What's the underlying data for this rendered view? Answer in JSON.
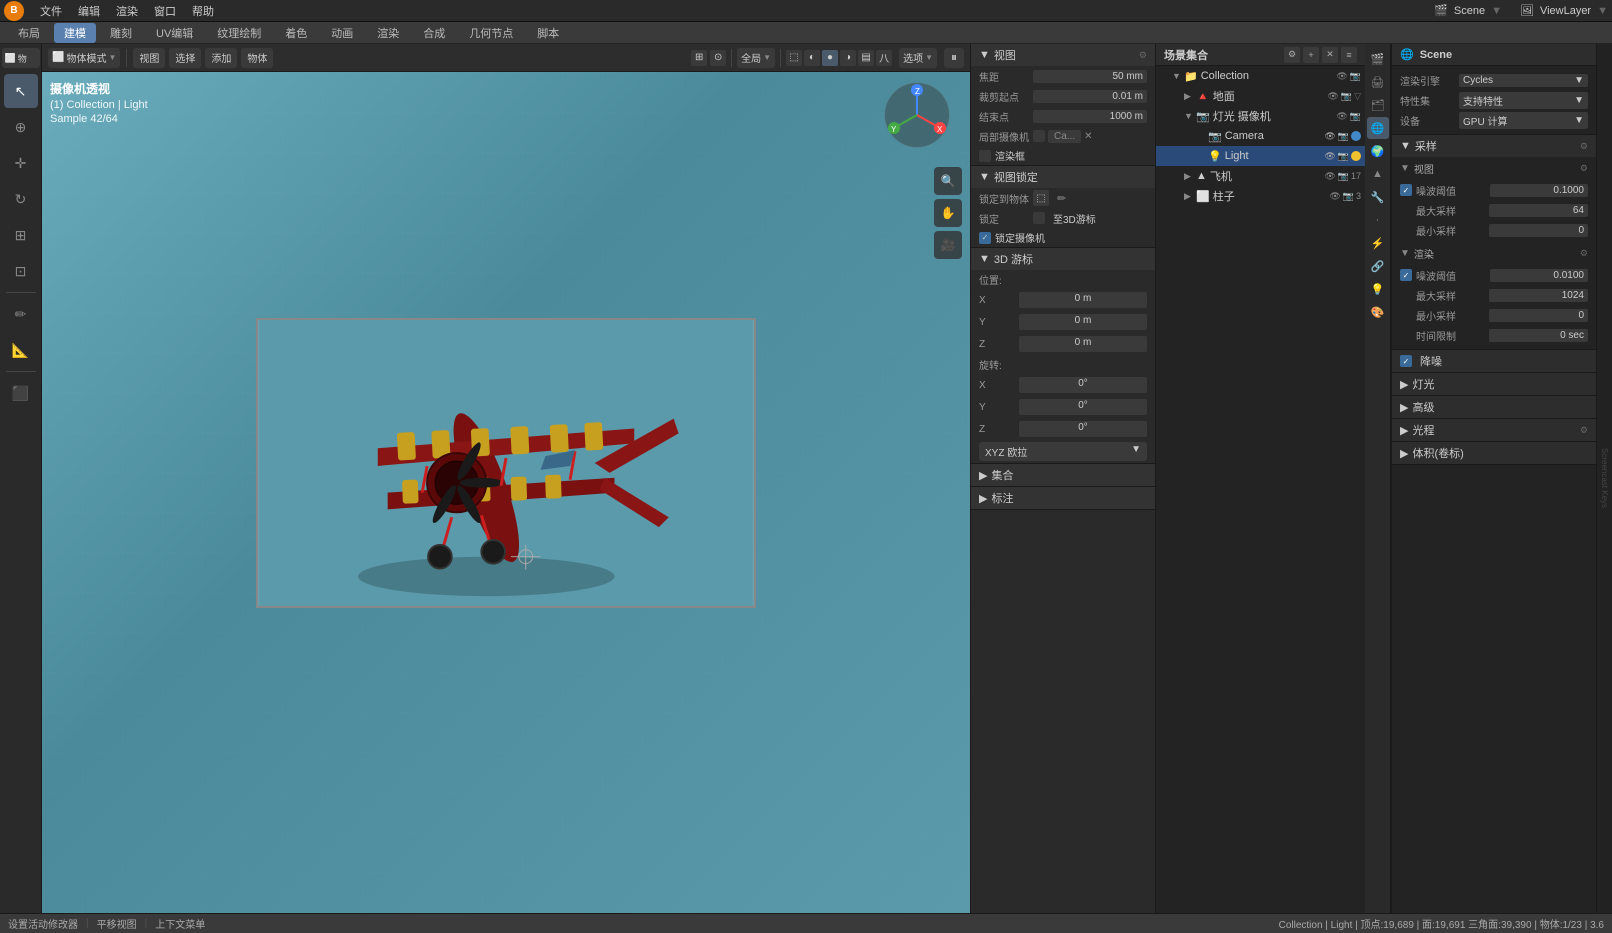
{
  "app": {
    "title": "Blender",
    "logo": "B"
  },
  "top_menu": {
    "items": [
      "文件",
      "编辑",
      "渲染",
      "窗口",
      "帮助"
    ]
  },
  "toolbar_tabs": {
    "items": [
      "布局",
      "建模",
      "雕刻",
      "UV编辑",
      "纹理绘制",
      "着色",
      "动画",
      "渲染",
      "合成",
      "几何节点",
      "脚本"
    ]
  },
  "viewport_toolbar": {
    "mode": "物体模式",
    "view": "视图",
    "select": "选择",
    "add": "添加",
    "object": "物体",
    "global": "全局",
    "options": "选项"
  },
  "viewport_info": {
    "title": "摄像机透视",
    "collection": "(1) Collection | Light",
    "sample": "Sample 42/64"
  },
  "right_panel": {
    "header": "视图",
    "focal_length_label": "焦距",
    "focal_length_value": "50 mm",
    "clip_start_label": "裁剪起点",
    "clip_start_value": "0.01 m",
    "clip_end_label": "结束点",
    "clip_end_value": "1000 m",
    "local_camera_label": "局部摄像机",
    "render_frame_label": "渲染框",
    "view_lock_header": "视图锁定",
    "lock_object_label": "锁定到物体",
    "lock_label": "锁定",
    "lock_to_3d_cursor_label": "至3D游标",
    "lock_camera_label": "锁定摄像机",
    "cursor_3d_header": "3D 游标",
    "position_label": "位置:",
    "x_label": "X",
    "x_value": "0 m",
    "y_label": "Y",
    "y_value": "0 m",
    "z_label": "Z",
    "z_value": "0 m",
    "rotation_label": "旋转:",
    "rx_label": "X",
    "rx_value": "0°",
    "ry_label": "Y",
    "ry_value": "0°",
    "rz_label": "Z",
    "rz_value": "0°",
    "xyz_label": "XYZ 欧拉",
    "collection_header": "集合",
    "annotation_header": "标注"
  },
  "scene_tree": {
    "title": "场景集合",
    "items": [
      {
        "id": "collection",
        "label": "Collection",
        "indent": 1,
        "expanded": true,
        "icon": "📁",
        "selected": false
      },
      {
        "id": "ground",
        "label": "地面",
        "indent": 2,
        "icon": "▲",
        "selected": false
      },
      {
        "id": "camera_light",
        "label": "灯光 摄像机",
        "indent": 2,
        "expanded": true,
        "icon": "📷",
        "selected": false
      },
      {
        "id": "camera",
        "label": "Camera",
        "indent": 3,
        "icon": "📷",
        "selected": false
      },
      {
        "id": "light",
        "label": "Light",
        "indent": 3,
        "icon": "💡",
        "selected": true
      },
      {
        "id": "plane",
        "label": "飞机",
        "indent": 2,
        "icon": "✈",
        "selected": false
      },
      {
        "id": "column",
        "label": "柱子",
        "indent": 2,
        "icon": "⬜",
        "selected": false
      }
    ]
  },
  "properties_panel": {
    "scene_label": "Scene",
    "render_engine_label": "渲染引擎",
    "render_engine_value": "Cycles",
    "feature_set_label": "特性集",
    "feature_set_value": "支持特性",
    "device_label": "设备",
    "device_value": "GPU 计算",
    "sampling_header": "采样",
    "viewport_header": "视图",
    "noise_threshold_label": "噪波阈值",
    "noise_threshold_value": "0.1000",
    "max_samples_label": "最大采样",
    "max_samples_value": "64",
    "min_samples_label": "最小采样",
    "min_samples_value": "0",
    "render_header": "渲染",
    "render_noise_threshold_label": "噪波阈值",
    "render_noise_threshold_value": "0.0100",
    "render_max_samples_label": "最大采样",
    "render_max_samples_value": "1024",
    "render_min_samples_label": "最小采样",
    "render_min_samples_value": "0",
    "time_limit_label": "时间限制",
    "time_limit_value": "0 sec",
    "denoising_header": "降噪",
    "lighting_header": "灯光",
    "advanced_header": "高级",
    "light_path_header": "光程",
    "volume_header": "体积(卷标)"
  },
  "status_bar": {
    "left": "设置活动修改器",
    "center_left": "平移视图",
    "center_right": "上下文菜单",
    "right": "Collection | Light | 顶点:19,689 | 面:19,691 三角面:39,390 | 物体:1/23 | 3.6"
  },
  "colors": {
    "accent_blue": "#4a80c0",
    "selected_row": "#2a4a7a",
    "active_light": "#f0c030",
    "viewport_bg": "#5a8a9a"
  }
}
